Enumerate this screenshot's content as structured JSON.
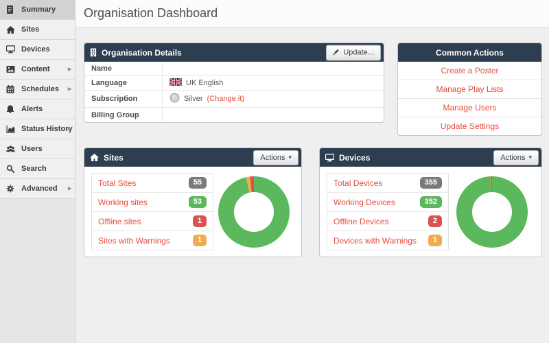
{
  "header": {
    "title": "Organisation Dashboard"
  },
  "icons": {
    "caret_down": "▾",
    "chevron_right": "▸"
  },
  "colors": {
    "panel_header": "#2d3e50",
    "accent_red": "#e74c3c",
    "badge_gray": "#7a7a7a",
    "badge_green": "#5cb85c",
    "badge_red": "#d9534f",
    "badge_orange": "#f0ad4e"
  },
  "sidebar": {
    "items": [
      {
        "label": "Summary",
        "icon": "document-icon",
        "active": true,
        "has_submenu": false
      },
      {
        "label": "Sites",
        "icon": "home-icon",
        "active": false,
        "has_submenu": false
      },
      {
        "label": "Devices",
        "icon": "monitor-icon",
        "active": false,
        "has_submenu": false
      },
      {
        "label": "Content",
        "icon": "image-icon",
        "active": false,
        "has_submenu": true
      },
      {
        "label": "Schedules",
        "icon": "calendar-icon",
        "active": false,
        "has_submenu": true
      },
      {
        "label": "Alerts",
        "icon": "bell-icon",
        "active": false,
        "has_submenu": false
      },
      {
        "label": "Status History",
        "icon": "area-chart-icon",
        "active": false,
        "has_submenu": true
      },
      {
        "label": "Users",
        "icon": "users-icon",
        "active": false,
        "has_submenu": false
      },
      {
        "label": "Search",
        "icon": "search-icon",
        "active": false,
        "has_submenu": false
      },
      {
        "label": "Advanced",
        "icon": "gear-icon",
        "active": false,
        "has_submenu": true
      }
    ]
  },
  "org_details": {
    "title": "Organisation Details",
    "icon": "building-icon",
    "update_button": "Update...",
    "rows": [
      {
        "label": "Name",
        "value": ""
      },
      {
        "label": "Language",
        "value": "UK English",
        "icon": "uk-flag-icon"
      },
      {
        "label": "Subscription",
        "value": "Silver",
        "link": "(Change it)",
        "icon": "silver-coin-icon"
      },
      {
        "label": "Billing Group",
        "value": ""
      }
    ]
  },
  "common_actions": {
    "title": "Common Actions",
    "links": [
      "Create a Poster",
      "Manage Play Lists",
      "Manage Users",
      "Update Settings"
    ]
  },
  "sites": {
    "title": "Sites",
    "icon": "home-icon",
    "actions_button": "Actions",
    "stats": [
      {
        "label": "Total Sites",
        "value": "55",
        "badge_color": "#7a7a7a"
      },
      {
        "label": "Working sites",
        "value": "53",
        "badge_color": "#5cb85c"
      },
      {
        "label": "Offline sites",
        "value": "1",
        "badge_color": "#d9534f"
      },
      {
        "label": "Sites with Warnings",
        "value": "1",
        "badge_color": "#f0ad4e"
      }
    ]
  },
  "devices": {
    "title": "Devices",
    "icon": "monitor-icon",
    "actions_button": "Actions",
    "stats": [
      {
        "label": "Total Devices",
        "value": "355",
        "badge_color": "#7a7a7a"
      },
      {
        "label": "Working Devices",
        "value": "352",
        "badge_color": "#5cb85c"
      },
      {
        "label": "Offline Devices",
        "value": "2",
        "badge_color": "#d9534f"
      },
      {
        "label": "Devices with Warnings",
        "value": "1",
        "badge_color": "#f0ad4e"
      }
    ]
  },
  "chart_data": [
    {
      "type": "pie",
      "subtype": "donut",
      "title": "Sites status donut",
      "total": 55,
      "legend": "none",
      "slices": [
        {
          "label": "Working sites",
          "value": 53,
          "color": "#5cb85c"
        },
        {
          "label": "Sites with Warnings",
          "value": 1,
          "color": "#f0ad4e"
        },
        {
          "label": "Offline sites",
          "value": 1,
          "color": "#d9534f"
        }
      ]
    },
    {
      "type": "pie",
      "subtype": "donut",
      "title": "Devices status donut",
      "total": 355,
      "legend": "none",
      "slices": [
        {
          "label": "Working Devices",
          "value": 352,
          "color": "#5cb85c"
        },
        {
          "label": "Devices with Warnings",
          "value": 1,
          "color": "#f0ad4e"
        },
        {
          "label": "Offline Devices",
          "value": 2,
          "color": "#d9534f"
        }
      ]
    }
  ]
}
